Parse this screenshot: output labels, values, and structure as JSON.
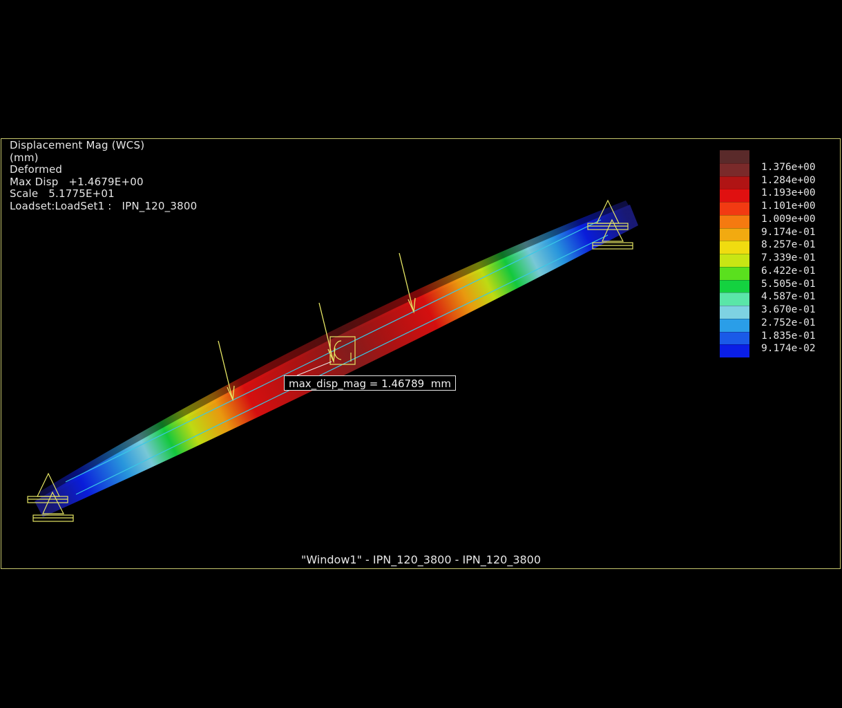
{
  "info": {
    "line1": "Displacement Mag (WCS)",
    "line2": "(mm)",
    "line3": "Deformed",
    "max_disp_label": "Max Disp",
    "max_disp_value": "+1.4679E+00",
    "scale_label": "Scale",
    "scale_value": "5.1775E+01",
    "loadset_label": "Loadset:LoadSet1 :",
    "loadset_value": "IPN_120_3800"
  },
  "legend": {
    "labels": [
      "1.376e+00",
      "1.284e+00",
      "1.193e+00",
      "1.101e+00",
      "1.009e+00",
      "9.174e-01",
      "8.257e-01",
      "7.339e-01",
      "6.422e-01",
      "5.505e-01",
      "4.587e-01",
      "3.670e-01",
      "2.752e-01",
      "1.835e-01",
      "9.174e-02"
    ],
    "colors": [
      "#7a2a2a",
      "#b01414",
      "#e01010",
      "#f23a12",
      "#f57a10",
      "#f2aa10",
      "#f0dc10",
      "#c8e614",
      "#5ae01e",
      "#14d240",
      "#5ae6a8",
      "#7ed2e2",
      "#2a9ee8",
      "#1a5ae8",
      "#0a1ee6"
    ]
  },
  "callout": {
    "text": "max_disp_mag = 1.46789  mm"
  },
  "footer": {
    "text": "\"Window1\"  -  IPN_120_3800  -  IPN_120_3800"
  },
  "colors": {
    "frame": "#c8c86e",
    "load_arrow": "#e6e664",
    "constraint": "#e6e664",
    "outline": "#3ac8e6"
  }
}
